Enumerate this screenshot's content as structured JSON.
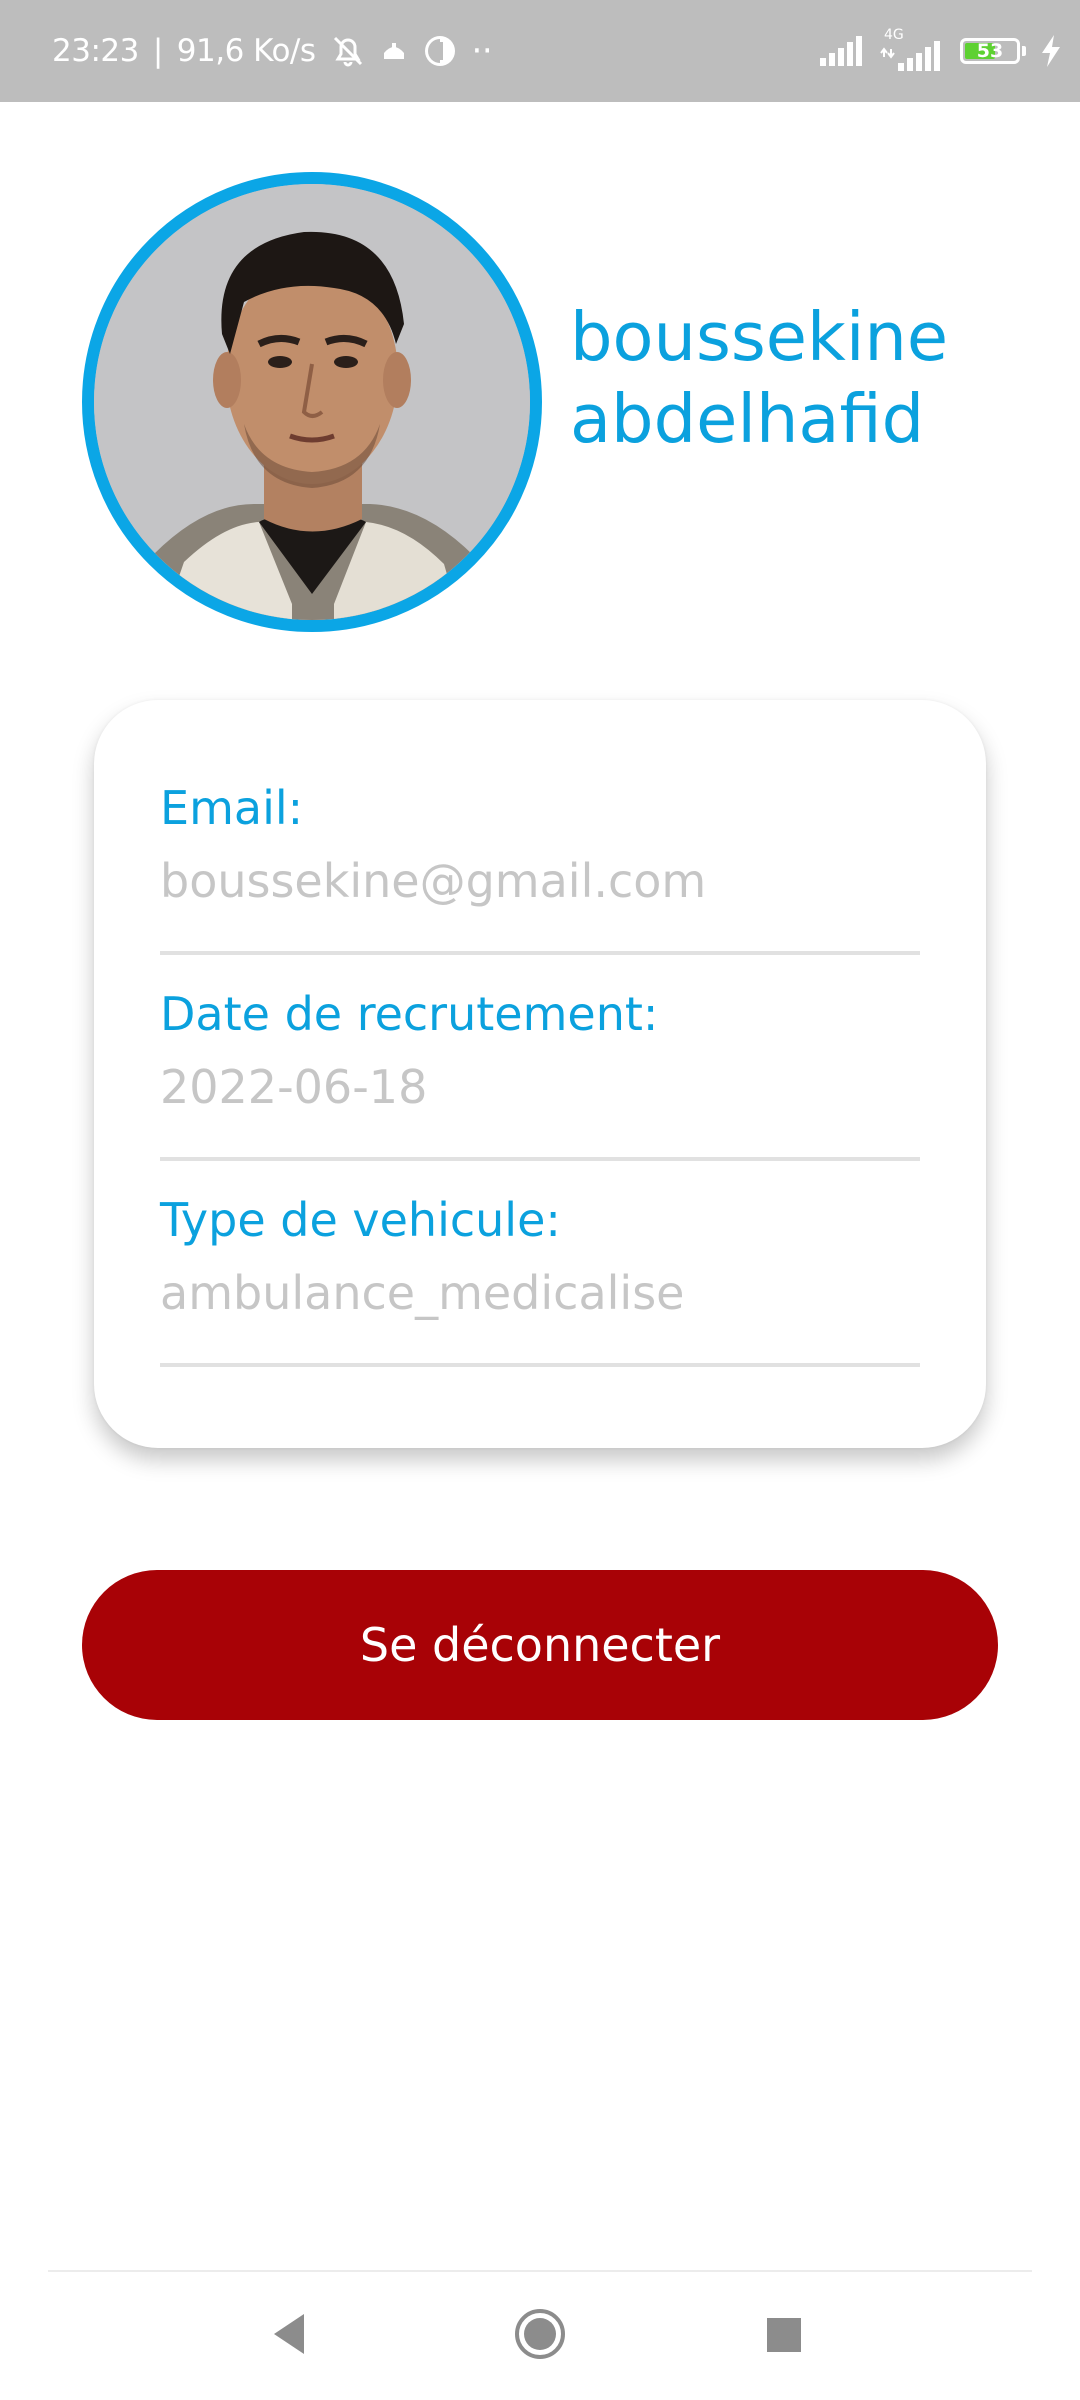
{
  "status_bar": {
    "time": "23:23",
    "separator": "|",
    "net_speed": "91,6 Ko/s",
    "dots": "··",
    "network_type": "4G",
    "battery_level": "53",
    "icons": [
      "bell-off-icon",
      "app-notification-icon",
      "data-saver-icon",
      "signal-icon",
      "signal-4g-icon",
      "battery-icon",
      "charging-icon"
    ]
  },
  "profile": {
    "name_line1": "boussekine",
    "name_line2": "abdelhafid",
    "avatar": "profile-photo"
  },
  "info": {
    "email_label": "Email:",
    "email_value": "boussekine@gmail.com",
    "date_label": "Date de recrutement:",
    "date_value": "2022-06-18",
    "vehicle_label": "Type de vehicule:",
    "vehicle_value": "ambulance_medicalise"
  },
  "actions": {
    "logout_label": "Se déconnecter"
  },
  "nav": {
    "icons": [
      "back-icon",
      "home-icon",
      "recents-icon"
    ]
  },
  "colors": {
    "accent": "#0ba1de",
    "danger": "#a80206",
    "status_bar": "#bdbdbd",
    "value_text": "#c6c6c6",
    "battery": "#5ed132"
  }
}
